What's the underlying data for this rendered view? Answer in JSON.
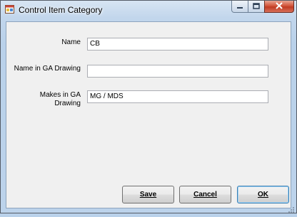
{
  "window": {
    "title": "Control Item Category",
    "icons": {
      "app": "app-window-icon",
      "minimize": "minimize-icon",
      "maximize": "maximize-icon",
      "close": "close-icon"
    }
  },
  "form": {
    "name_label": "Name",
    "name_value": "CB",
    "ga_name_label": "Name in GA Drawing",
    "ga_name_value": "",
    "makes_label_line1": "Makes in GA",
    "makes_label_line2": "Drawing",
    "makes_value": "MG / MDS"
  },
  "buttons": {
    "save": "Save",
    "cancel": "Cancel",
    "ok": "OK"
  }
}
